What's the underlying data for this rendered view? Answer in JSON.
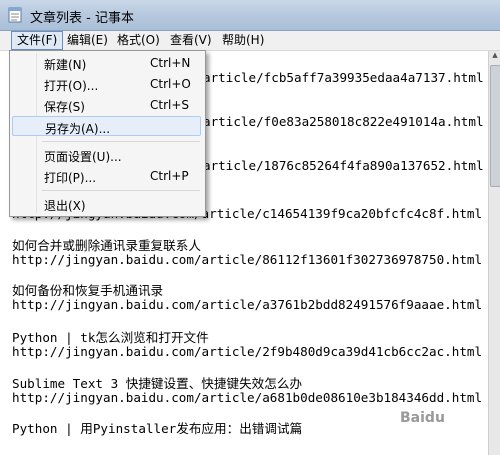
{
  "window": {
    "title": "文章列表 - 记事本"
  },
  "menubar": {
    "items": [
      {
        "label": "文件(F)"
      },
      {
        "label": "编辑(E)"
      },
      {
        "label": "格式(O)"
      },
      {
        "label": "查看(V)"
      },
      {
        "label": "帮助(H)"
      }
    ]
  },
  "file_menu": {
    "items": [
      {
        "label": "新建(N)",
        "shortcut": "Ctrl+N"
      },
      {
        "label": "打开(O)...",
        "shortcut": "Ctrl+O"
      },
      {
        "label": "保存(S)",
        "shortcut": "Ctrl+S"
      },
      {
        "label": "另存为(A)...",
        "shortcut": ""
      },
      {
        "label": "页面设置(U)...",
        "shortcut": ""
      },
      {
        "label": "打印(P)...",
        "shortcut": "Ctrl+P"
      },
      {
        "label": "退出(X)",
        "shortcut": ""
      }
    ]
  },
  "document": {
    "lines": [
      "article/fcb5aff7a39935edaa4a7137.html",
      "article/f0e83a258018c822e491014a.html",
      "article/1876c85264f4fa890a137652.html",
      "http://jingyan.baidu.com/article/c14654139f9ca20bfcfc4c8f.html",
      "如何合并或删除通讯录重复联系人",
      "http://jingyan.baidu.com/article/86112f13601f302736978750.html",
      "如何备份和恢复手机通讯录",
      "http://jingyan.baidu.com/article/a3761b2bdd82491576f9aaae.html",
      "Python | tk怎么浏览和打开文件",
      "http://jingyan.baidu.com/article/2f9b480d9ca39d41cb6cc2ac.html",
      "Sublime Text 3 快捷键设置、快捷键失效怎么办",
      "http://jingyan.baidu.com/article/a681b0de08610e3b184346dd.html",
      "Python | 用Pyinstaller发布应用：出错调试篇"
    ]
  },
  "watermark": "Baidu"
}
